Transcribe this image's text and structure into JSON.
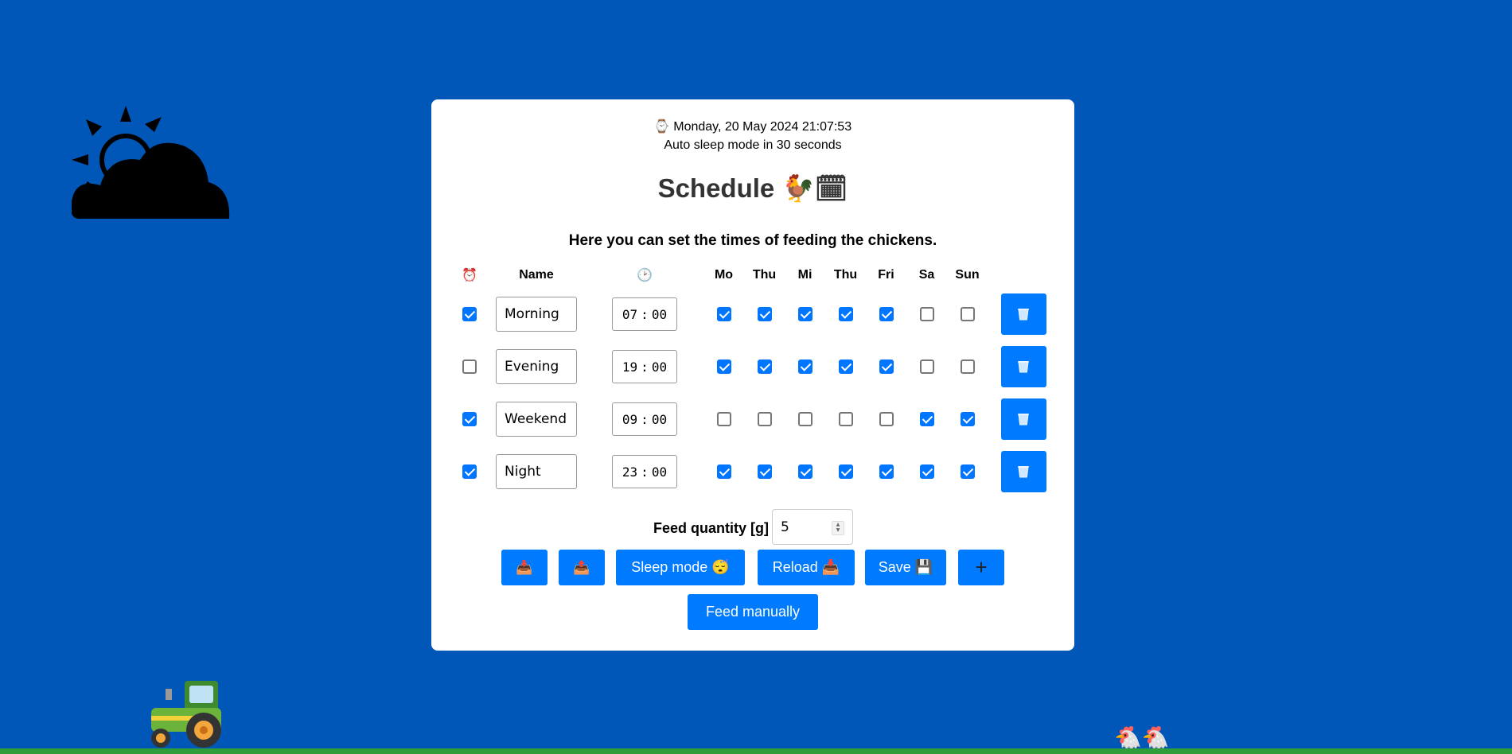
{
  "status": {
    "clock_icon": "watch-icon",
    "datetime": "⌚ Monday, 20 May 2024 21:07:53",
    "sleep_notice": "Auto sleep mode in 30 seconds"
  },
  "title": "Schedule 🐓🗓",
  "subtitle": "Here you can set the times of feeding the chickens.",
  "table": {
    "headers": {
      "enabled": "⏰",
      "name": "Name",
      "time": "🕑",
      "days": [
        "Mo",
        "Thu",
        "Mi",
        "Thu",
        "Fri",
        "Sa",
        "Sun"
      ]
    },
    "rows": [
      {
        "enabled": true,
        "name": "Morning",
        "hour": "07",
        "minute": "00",
        "days": [
          true,
          true,
          true,
          true,
          true,
          false,
          false
        ]
      },
      {
        "enabled": false,
        "name": "Evening",
        "hour": "19",
        "minute": "00",
        "days": [
          true,
          true,
          true,
          true,
          true,
          false,
          false
        ]
      },
      {
        "enabled": true,
        "name": "Weekend",
        "hour": "09",
        "minute": "00",
        "days": [
          false,
          false,
          false,
          false,
          false,
          true,
          true
        ]
      },
      {
        "enabled": true,
        "name": "Night",
        "hour": "23",
        "minute": "00",
        "days": [
          true,
          true,
          true,
          true,
          true,
          true,
          true
        ]
      }
    ],
    "time_separator": ":",
    "delete_icon": "trash-icon"
  },
  "feed": {
    "label": "Feed quantity [g]",
    "value": "5"
  },
  "buttons": {
    "download": "📥",
    "upload": "📤",
    "sleep": "Sleep mode 😴",
    "reload": "Reload 📥",
    "save": "Save 💾",
    "add": "+",
    "feed_manually": "Feed manually"
  },
  "decor": {
    "weather_icon": "sun-behind-cloud-icon",
    "tractor_icon": "tractor-icon",
    "chickens": "🐔🐔"
  },
  "colors": {
    "background": "#0057b8",
    "accent": "#007bff",
    "checkbox": "#0075ff",
    "ground": "#2e9e3a"
  }
}
